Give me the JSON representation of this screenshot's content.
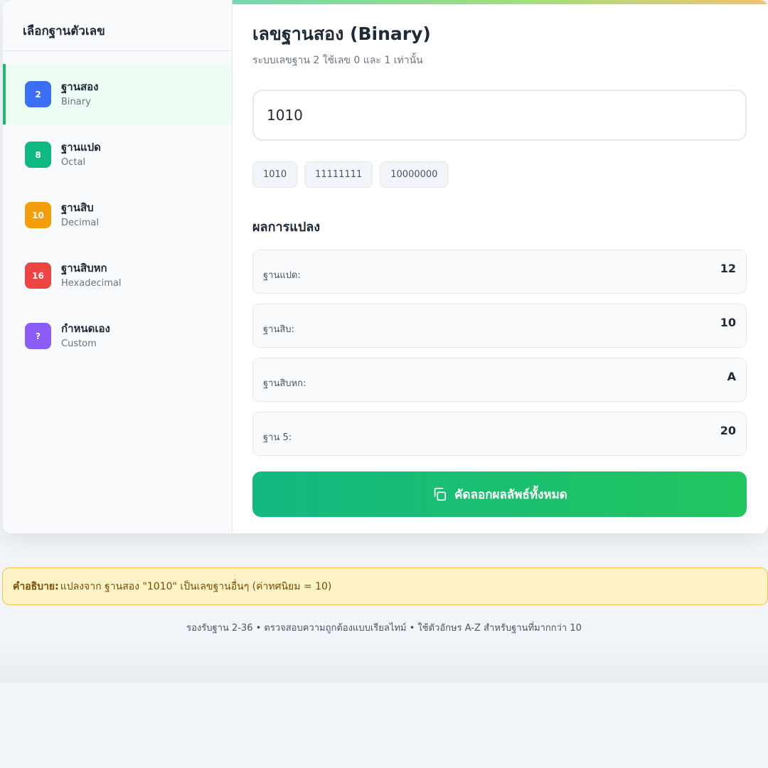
{
  "sidebar": {
    "title": "เลือกฐานตัวเลข",
    "items": [
      {
        "badge": "2",
        "title": "ฐานสอง",
        "subtitle": "Binary",
        "color": "#3b6ff5",
        "active": true
      },
      {
        "badge": "8",
        "title": "ฐานแปด",
        "subtitle": "Octal",
        "color": "#10b981",
        "active": false
      },
      {
        "badge": "10",
        "title": "ฐานสิบ",
        "subtitle": "Decimal",
        "color": "#f59e0b",
        "active": false
      },
      {
        "badge": "16",
        "title": "ฐานสิบหก",
        "subtitle": "Hexadecimal",
        "color": "#ef4444",
        "active": false
      },
      {
        "badge": "?",
        "title": "กำหนดเอง",
        "subtitle": "Custom",
        "color": "#8b5cf6",
        "active": false
      }
    ]
  },
  "main": {
    "title": "เลขฐานสอง (Binary)",
    "subtitle": "ระบบเลขฐาน 2 ใช้เลข 0 และ 1 เท่านั้น",
    "input_value": "1010",
    "examples": [
      "1010",
      "11111111",
      "10000000"
    ],
    "results_heading": "ผลการแปลง",
    "results": [
      {
        "label": "ฐานแปด:",
        "value": "12"
      },
      {
        "label": "ฐานสิบ:",
        "value": "10"
      },
      {
        "label": "ฐานสิบหก:",
        "value": "A"
      },
      {
        "label": "ฐาน 5:",
        "value": "20"
      }
    ],
    "copy_button": "คัดลอกผลลัพธ์ทั้งหมด",
    "copy_icon": "copy-icon"
  },
  "note": {
    "label": "คำอธิบาย:",
    "text": "แปลงจาก ฐานสอง \"1010\" เป็นเลขฐานอื่นๆ (ค่าทศนิยม = 10)"
  },
  "footer": {
    "text": "รองรับฐาน 2-36 • ตรวจสอบความถูกต้องแบบเรียลไทม์ • ใช้ตัวอักษร A-Z สำหรับฐานที่มากกว่า 10"
  },
  "colors": {
    "accent": "#22b573",
    "active_bg": "#ecfdf3",
    "note_bg": "#fef3c7",
    "note_border": "#f0c34a"
  }
}
